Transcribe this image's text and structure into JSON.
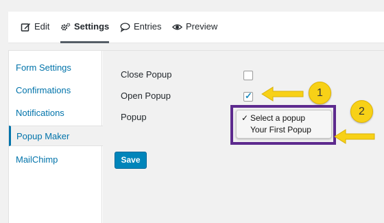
{
  "tabs": [
    {
      "label": "Edit",
      "icon": "edit-icon"
    },
    {
      "label": "Settings",
      "icon": "gear-icon",
      "active": true
    },
    {
      "label": "Entries",
      "icon": "speech-bubble-icon"
    },
    {
      "label": "Preview",
      "icon": "eye-icon"
    }
  ],
  "sidebar": {
    "items": [
      {
        "label": "Form Settings"
      },
      {
        "label": "Confirmations"
      },
      {
        "label": "Notifications"
      },
      {
        "label": "Popup Maker",
        "active": true
      },
      {
        "label": "MailChimp"
      }
    ]
  },
  "form": {
    "close_popup_label": "Close Popup",
    "close_popup_checked": false,
    "open_popup_label": "Open Popup",
    "open_popup_checked": true,
    "popup_label": "Popup",
    "popup_options": [
      "Select a popup",
      "Your First Popup"
    ],
    "popup_selected": "Select a popup",
    "save_label": "Save"
  },
  "annotations": {
    "badge_1": "1",
    "badge_2": "2",
    "badge_color": "#f7d117",
    "highlight_color": "#5d2a8e"
  },
  "colors": {
    "accent": "#0085ba",
    "link": "#0073aa"
  }
}
